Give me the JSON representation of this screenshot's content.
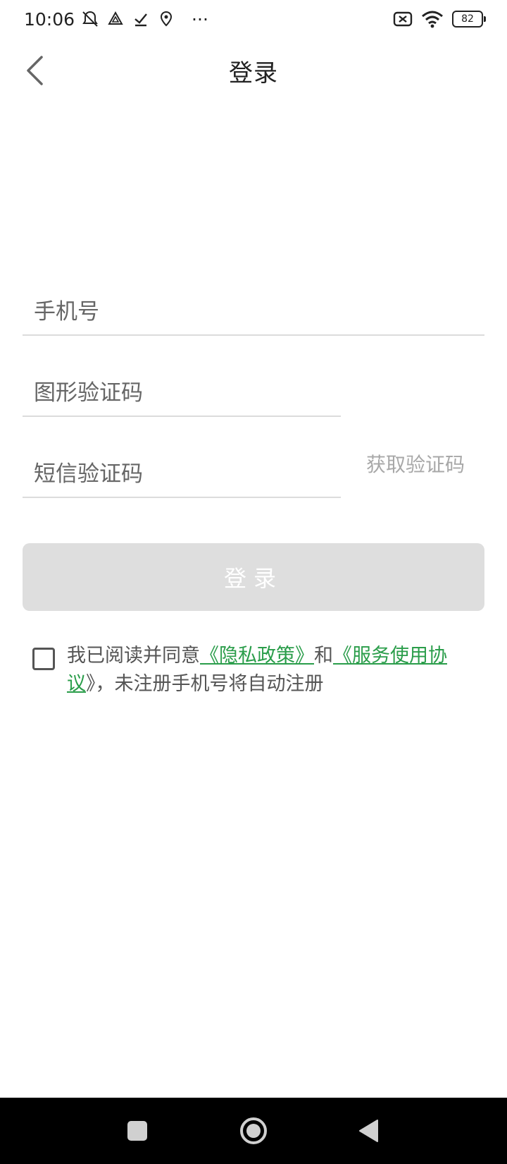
{
  "status_bar": {
    "time": "10:06",
    "more": "···",
    "battery": "82",
    "icons": [
      "mute-bell-icon",
      "drive-icon",
      "check-icon",
      "location-icon",
      "no-sim-icon",
      "wifi-icon",
      "battery-icon"
    ]
  },
  "header": {
    "title": "登录",
    "back_icon": "chevron-left-icon"
  },
  "form": {
    "phone_placeholder": "手机号",
    "captcha_placeholder": "图形验证码",
    "sms_placeholder": "短信验证码",
    "get_code_label": "获取验证码",
    "login_label": "登录"
  },
  "agreement": {
    "prefix": "我已阅读并同意",
    "privacy_link": "《隐私政策》",
    "and": "和",
    "service_link_part1": "《服务使用协",
    "service_link_part2": "议",
    "suffix": "》，未注册手机号将自动注册",
    "checked": false
  },
  "nav_bar": {
    "icons": [
      "recent-apps-icon",
      "home-icon",
      "back-triangle-icon"
    ]
  },
  "colors": {
    "link_green": "#2a9d4a",
    "button_disabled": "#dedede",
    "get_code_gray": "#a8a8a8",
    "nav_black": "#000000"
  }
}
